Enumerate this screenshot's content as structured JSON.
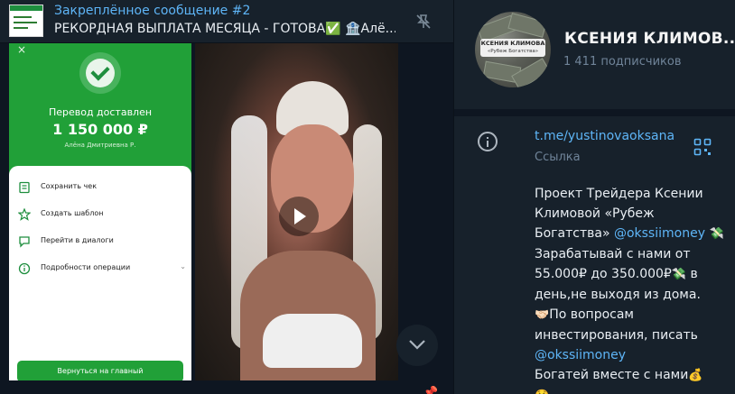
{
  "pinned": {
    "title": "Закреплённое сообщение #2",
    "text": "РЕКОРДНАЯ ВЫПЛАТА МЕСЯЦА - ГОТОВА✅ 🏦Алё..."
  },
  "receipt": {
    "close": "×",
    "title": "Перевод доставлен",
    "amount": "1 150 000 ₽",
    "recipient": "Алёна Дмитриевна Р.",
    "actions": [
      {
        "label": "Сохранить чек",
        "icon": "receipt-icon"
      },
      {
        "label": "Создать шаблон",
        "icon": "star-badge-icon"
      },
      {
        "label": "Перейти в диалоги",
        "icon": "chat-icon"
      },
      {
        "label": "Подробности операции",
        "icon": "info-icon"
      }
    ],
    "home_button": "Вернуться на главный"
  },
  "channel": {
    "name": "КСЕНИЯ КЛИМОВ...",
    "subscribers": "1 411 подписчиков",
    "avatar_title": "КСЕНИЯ КЛИМОВА",
    "avatar_subtitle": "«Рубеж Богатства»"
  },
  "info": {
    "link": "t.me/yustinovaoksana",
    "link_label": "Ссылка",
    "description": {
      "line1": "Проект Трейдера Ксении Климовой «Рубеж Богатства»",
      "mention1": "@okssiimoney",
      "emoji1": "💸",
      "line2": "Зарабатывай с нами от 55.000₽ до 350.000₽",
      "emoji2": "💸",
      "line3": " в день,не выходя из дома.",
      "emoji3": "🤝🏻",
      "line4": "По вопросам инвестирования, писать",
      "mention2": "@okssiimoney",
      "line5": "Богатей вместе с нами",
      "emoji4": "💰",
      "emoji5": "🤑"
    }
  },
  "colors": {
    "accent": "#5eb5f7",
    "panel": "#17212b",
    "background": "#0e1621",
    "sber_green": "#21a038"
  }
}
